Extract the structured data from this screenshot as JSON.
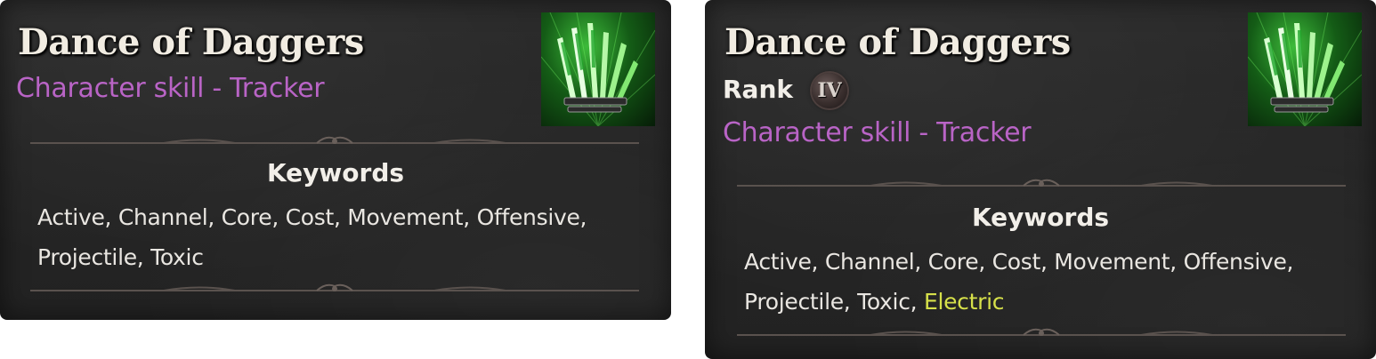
{
  "tooltips": [
    {
      "title": "Dance of Daggers",
      "subtitle": "Character skill - Tracker",
      "keywords_heading": "Keywords",
      "keywords_line1": "Active, Channel, Core, Cost, Movement, Offensive,",
      "keywords_line2": "Projectile, Toxic",
      "icon": "dance-of-daggers-skill-icon"
    },
    {
      "title": "Dance of Daggers",
      "rank_label": "Rank",
      "rank_value": "IV",
      "subtitle": "Character skill - Tracker",
      "keywords_heading": "Keywords",
      "keywords_line1": "Active, Channel, Core, Cost, Movement, Offensive,",
      "keywords_line2": "Projectile, Toxic,",
      "keywords_extra": "Electric",
      "icon": "dance-of-daggers-skill-icon"
    }
  ],
  "colors": {
    "subtitle": "#b964c6",
    "electric_keyword": "#d6e04a",
    "title": "#f1ece2",
    "panel": "#262626"
  }
}
